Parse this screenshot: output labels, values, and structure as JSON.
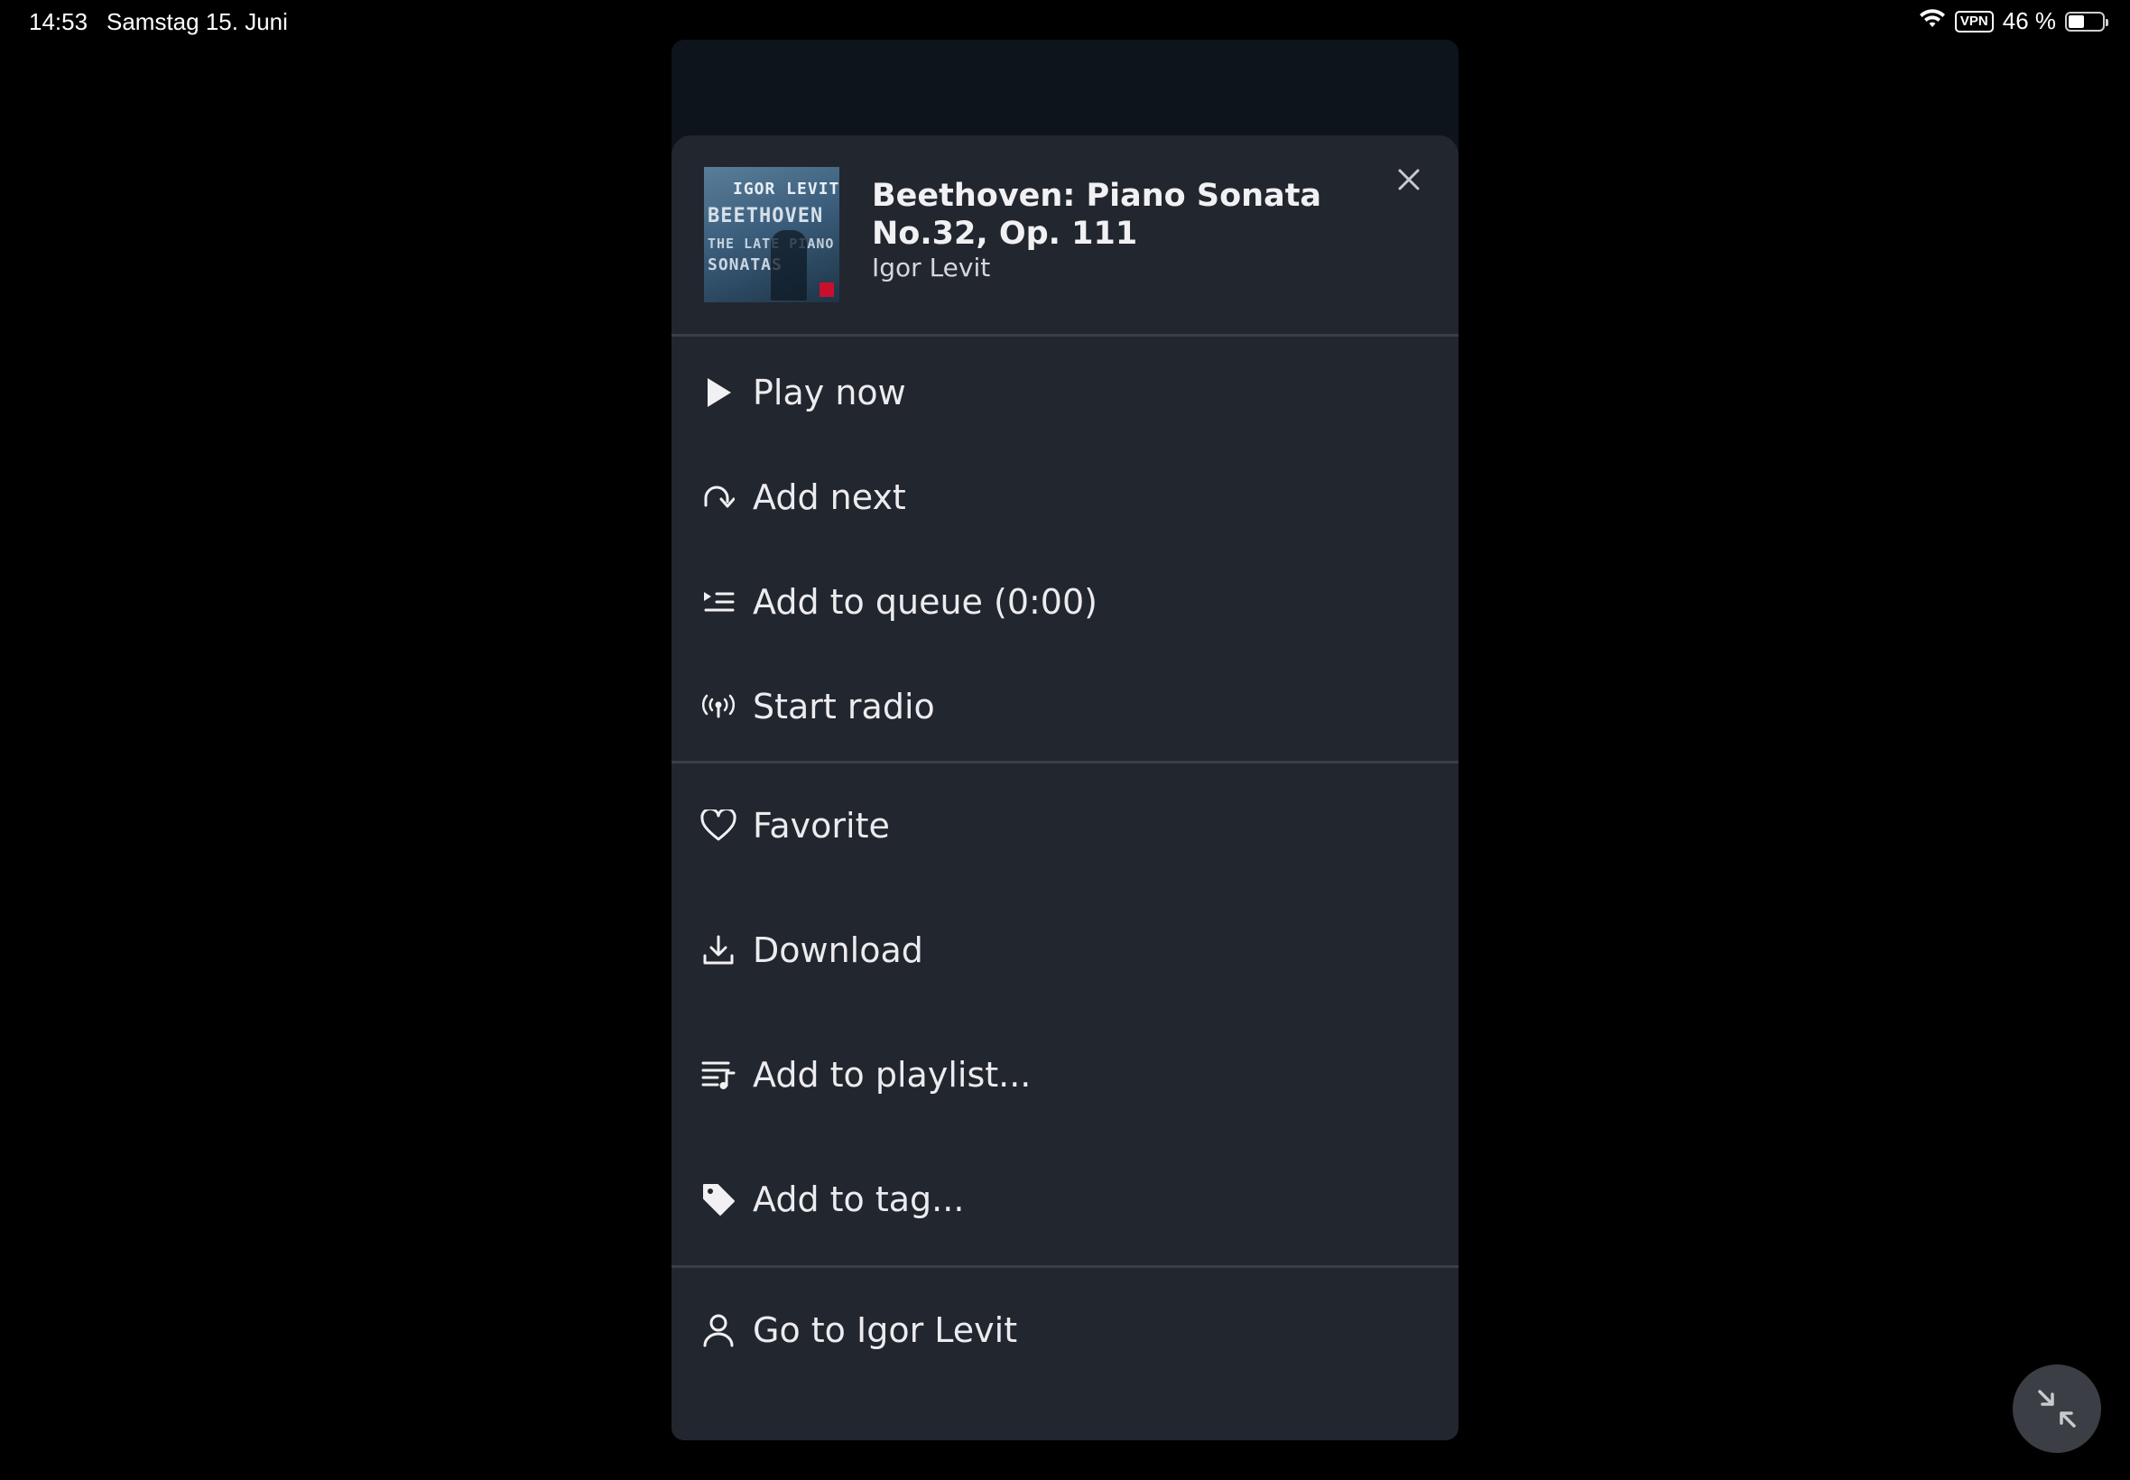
{
  "status_bar": {
    "time": "14:53",
    "date": "Samstag 15. Juni",
    "vpn": "VPN",
    "battery_text": "46 %",
    "battery_level": 0.46
  },
  "track": {
    "title": "Beethoven: Piano Sonata No.32, Op. 111",
    "artist": "Igor Levit",
    "art": {
      "line1": "IGOR LEVIT",
      "line2": "BEETHOVEN",
      "line3": "THE LATE PIANO",
      "line4": "SONATAS"
    }
  },
  "menu": {
    "group1": [
      {
        "label": "Play now",
        "icon": "play-icon"
      },
      {
        "label": "Add next",
        "icon": "add-next-icon"
      },
      {
        "label": "Add to queue (0:00)",
        "icon": "queue-icon"
      },
      {
        "label": "Start radio",
        "icon": "radio-icon"
      }
    ],
    "group2": [
      {
        "label": "Favorite",
        "icon": "heart-icon"
      },
      {
        "label": "Download",
        "icon": "download-icon"
      },
      {
        "label": "Add to playlist...",
        "icon": "playlist-icon"
      },
      {
        "label": "Add to tag...",
        "icon": "tag-icon"
      }
    ],
    "group3": [
      {
        "label": "Go to Igor Levit",
        "icon": "person-icon"
      }
    ]
  },
  "colors": {
    "background": "#000000",
    "sheet": "#22262f",
    "text": "#ececef"
  }
}
